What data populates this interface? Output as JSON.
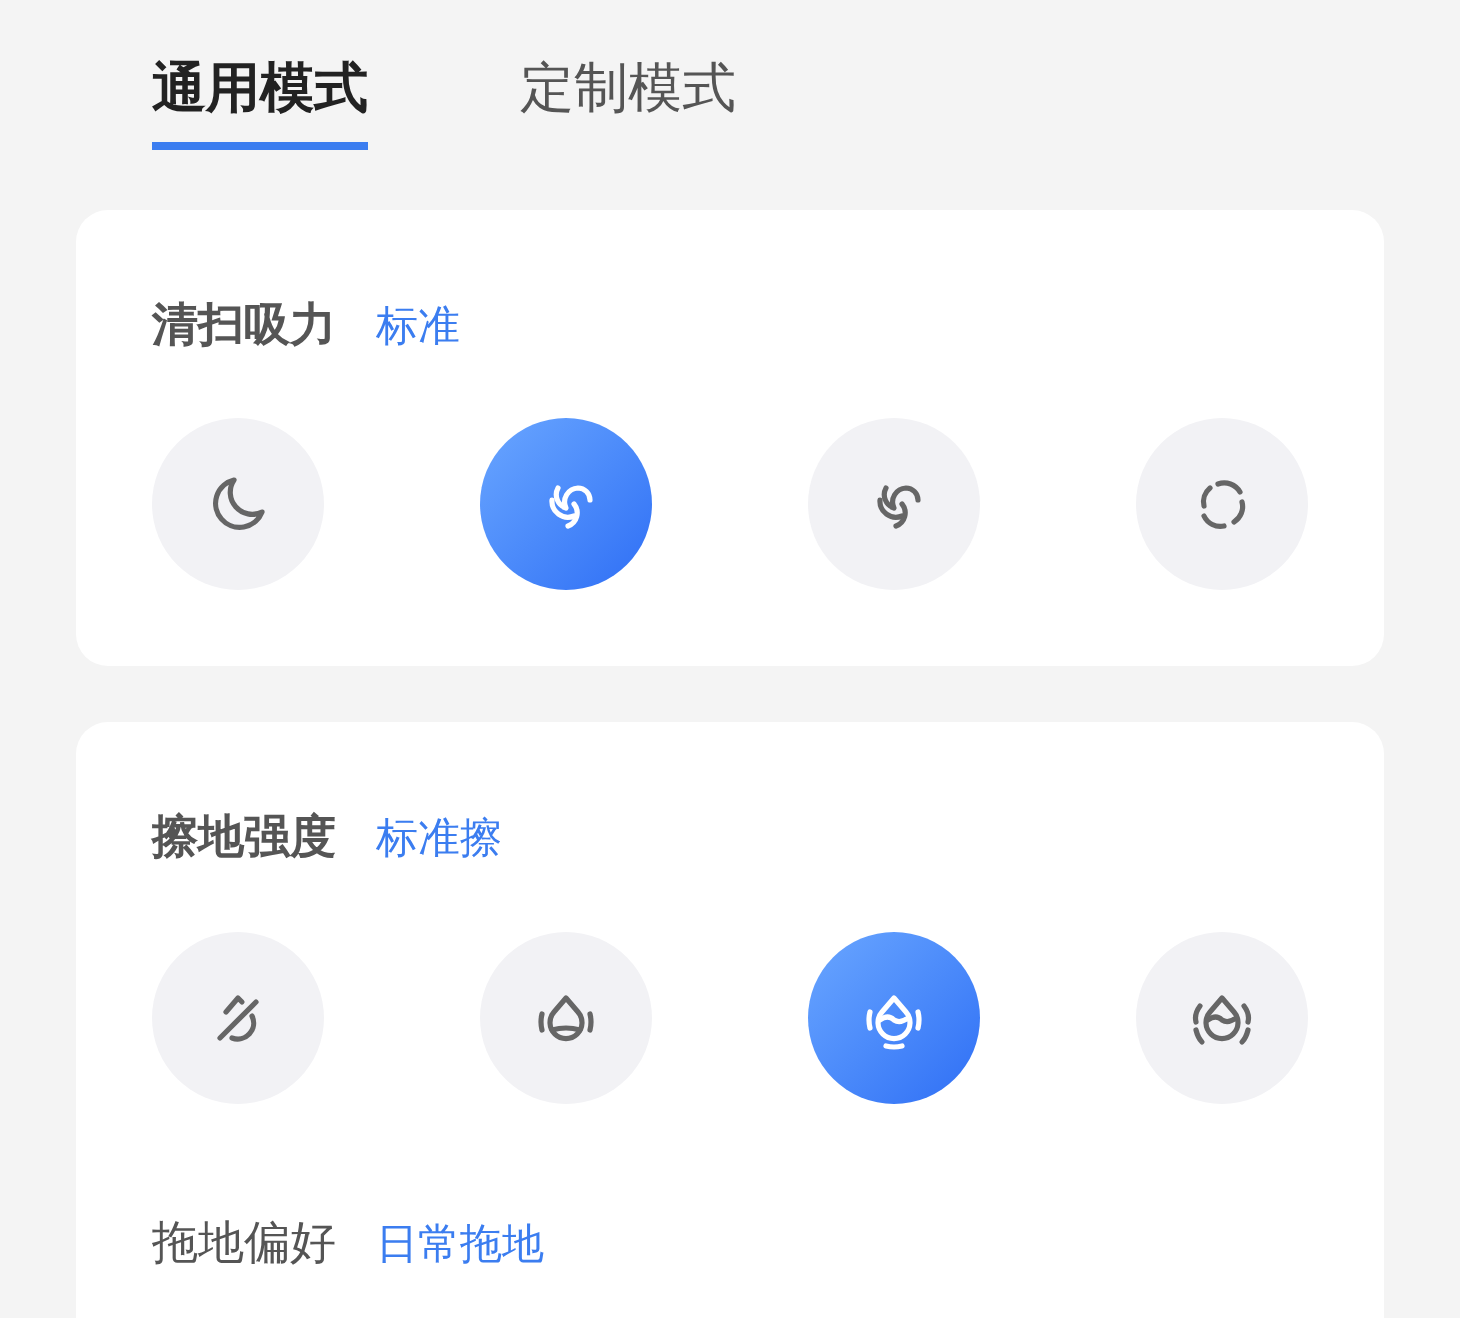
{
  "tabs": [
    {
      "label": "通用模式",
      "selected": true
    },
    {
      "label": "定制模式",
      "selected": false
    }
  ],
  "suction": {
    "title": "清扫吸力",
    "value": "标准",
    "options": [
      {
        "kind": "moon",
        "selected": false
      },
      {
        "kind": "swirl3",
        "selected": true
      },
      {
        "kind": "swirl3",
        "selected": false
      },
      {
        "kind": "swirl4",
        "selected": false
      }
    ]
  },
  "mopping": {
    "title": "擦地强度",
    "value": "标准擦",
    "options": [
      {
        "kind": "drop-off",
        "selected": false
      },
      {
        "kind": "drop-low",
        "selected": false
      },
      {
        "kind": "drop-mid",
        "selected": true
      },
      {
        "kind": "drop-high",
        "selected": false
      }
    ],
    "preference": {
      "title": "拖地偏好",
      "value": "日常拖地"
    }
  }
}
